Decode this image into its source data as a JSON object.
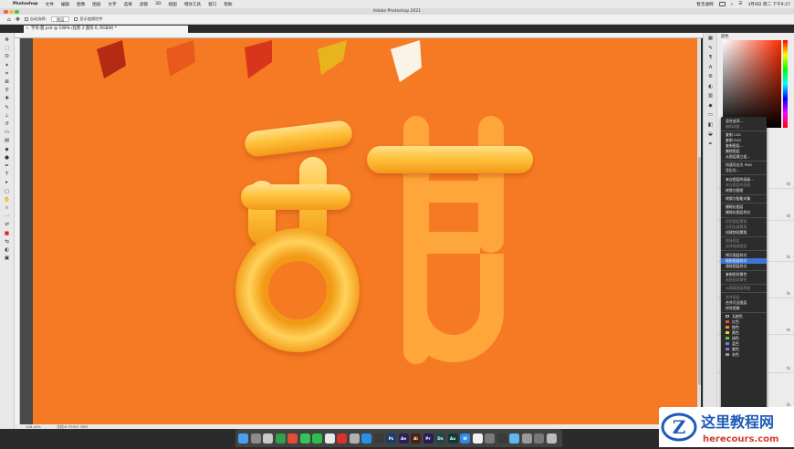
{
  "menubar": {
    "app_name": "Photoshop",
    "menus": [
      "文件",
      "编辑",
      "图像",
      "图层",
      "文字",
      "选择",
      "滤镜",
      "3D",
      "视图",
      "增效工具",
      "窗口",
      "帮助"
    ],
    "status_text": "暂无收网",
    "datetime": "3月9日 周二 下午9:27"
  },
  "window": {
    "title": "Adobe Photoshop 2021"
  },
  "options_bar": {
    "auto_select_label": "自动选择:",
    "auto_select_value": "图层",
    "show_transform_label": "显示变换控件"
  },
  "document": {
    "tab_label": "字母-甜.psd @ 148% (投影 2 圆形 6, RGB/8) *",
    "zoom": "148.44%",
    "doc_info": "文档:6.37M/7.78M"
  },
  "canvas": {
    "background_color": "#f57a23",
    "glyph": "甜",
    "paint_swatches": [
      "#b42a12",
      "#e85a1c",
      "#d8361a",
      "#e8b41c",
      "#faf3e8"
    ]
  },
  "panel": {
    "title": "颜色"
  },
  "context_menu": {
    "groups": [
      [
        {
          "label": "混合选项...",
          "enabled": true
        },
        {
          "label": "编辑调整...",
          "enabled": false
        }
      ],
      [
        {
          "label": "复制 CSS",
          "enabled": true
        },
        {
          "label": "复制 SVG",
          "enabled": true
        },
        {
          "label": "复制图层...",
          "enabled": true
        },
        {
          "label": "删除图层",
          "enabled": true
        },
        {
          "label": "从图层建立组...",
          "enabled": true
        }
      ],
      [
        {
          "label": "快速导出为 PNG",
          "enabled": true
        },
        {
          "label": "导出为...",
          "enabled": true
        }
      ],
      [
        {
          "label": "来自图层的画板...",
          "enabled": true
        },
        {
          "label": "来自图层的画框...",
          "enabled": false
        },
        {
          "label": "转换为图框",
          "enabled": true
        }
      ],
      [
        {
          "label": "转换为智能对象",
          "enabled": true
        }
      ],
      [
        {
          "label": "栅格化图层",
          "enabled": true
        },
        {
          "label": "栅格化图层样式",
          "enabled": true
        }
      ],
      [
        {
          "label": "停用图层蒙版",
          "enabled": false
        },
        {
          "label": "启用矢量蒙版",
          "enabled": false
        },
        {
          "label": "创建剪贴蒙版",
          "enabled": true
        }
      ],
      [
        {
          "label": "链接图层",
          "enabled": false
        },
        {
          "label": "选择链接图层",
          "enabled": false
        }
      ],
      [
        {
          "label": "拷贝图层样式",
          "enabled": true
        },
        {
          "label": "粘贴图层样式",
          "enabled": true,
          "highlighted": true
        },
        {
          "label": "清除图层样式",
          "enabled": true
        }
      ],
      [
        {
          "label": "复制形状属性",
          "enabled": true
        },
        {
          "label": "粘贴形状属性",
          "enabled": false
        }
      ],
      [
        {
          "label": "从隔离图层释放",
          "enabled": false
        }
      ],
      [
        {
          "label": "合并图层",
          "enabled": false
        },
        {
          "label": "合并可见图层",
          "enabled": true
        },
        {
          "label": "拼合图像",
          "enabled": true
        }
      ]
    ],
    "colors": [
      {
        "label": "无颜色",
        "color": "#2c2c2c"
      },
      {
        "label": "红色",
        "color": "#e0533b"
      },
      {
        "label": "橙色",
        "color": "#f0902a"
      },
      {
        "label": "黄色",
        "color": "#e8d23a"
      },
      {
        "label": "绿色",
        "color": "#6cc04a"
      },
      {
        "label": "蓝色",
        "color": "#5a8fe0"
      },
      {
        "label": "紫色",
        "color": "#9a6ad8"
      },
      {
        "label": "灰色",
        "color": "#9a9a9a"
      }
    ]
  },
  "layers": {
    "fx_label": "fx"
  },
  "dock": {
    "apps": [
      {
        "name": "Finder",
        "label": "",
        "color": "#4aa0f0"
      },
      {
        "name": "Launchpad",
        "label": "",
        "color": "#8c8c8c"
      },
      {
        "name": "Photos",
        "label": "",
        "color": "#c9c9c9"
      },
      {
        "name": "Chrome",
        "label": "",
        "color": "#2fa24a"
      },
      {
        "name": "Scissors",
        "label": "",
        "color": "#e64c3c"
      },
      {
        "name": "Messages",
        "label": "",
        "color": "#37c25a"
      },
      {
        "name": "WeChat",
        "label": "",
        "color": "#2dbd4e"
      },
      {
        "name": "Weibo",
        "label": "",
        "color": "#e8e8e8"
      },
      {
        "name": "NetEase Music",
        "label": "",
        "color": "#d8342c"
      },
      {
        "name": "Dictionary",
        "label": "",
        "color": "#b0b0b0"
      },
      {
        "name": "QQ",
        "label": "",
        "color": "#2a8fe8"
      },
      {
        "name": "Music",
        "label": "",
        "color": "#3a3a3a"
      },
      {
        "name": "Photoshop",
        "label": "Ps",
        "color": "#1c3b6e"
      },
      {
        "name": "After Effects",
        "label": "Ae",
        "color": "#2a1f58"
      },
      {
        "name": "Illustrator",
        "label": "Ai",
        "color": "#4a2410"
      },
      {
        "name": "Premiere",
        "label": "Pr",
        "color": "#2a1a5c"
      },
      {
        "name": "Dimension",
        "label": "Dn",
        "color": "#1b4a45"
      },
      {
        "name": "Audition",
        "label": "Au",
        "color": "#0c3b36"
      },
      {
        "name": "WPS",
        "label": "W",
        "color": "#2e8be6"
      },
      {
        "name": "Notes",
        "label": "",
        "color": "#f2f2f2"
      },
      {
        "name": "Preview",
        "label": "",
        "color": "#7a7a7a"
      },
      {
        "name": "Tool",
        "label": "",
        "color": "#3a3a3a"
      },
      {
        "name": "Folder",
        "label": "",
        "color": "#5fb6f0"
      },
      {
        "name": "Settings",
        "label": "",
        "color": "#9a9a9a"
      },
      {
        "name": "Screenshot",
        "label": "",
        "color": "#777777"
      },
      {
        "name": "Trash",
        "label": "",
        "color": "#bdbdbd"
      }
    ]
  },
  "watermark": {
    "title": "这里教程网",
    "url": "herecours.com",
    "logo_letter": "Z"
  }
}
